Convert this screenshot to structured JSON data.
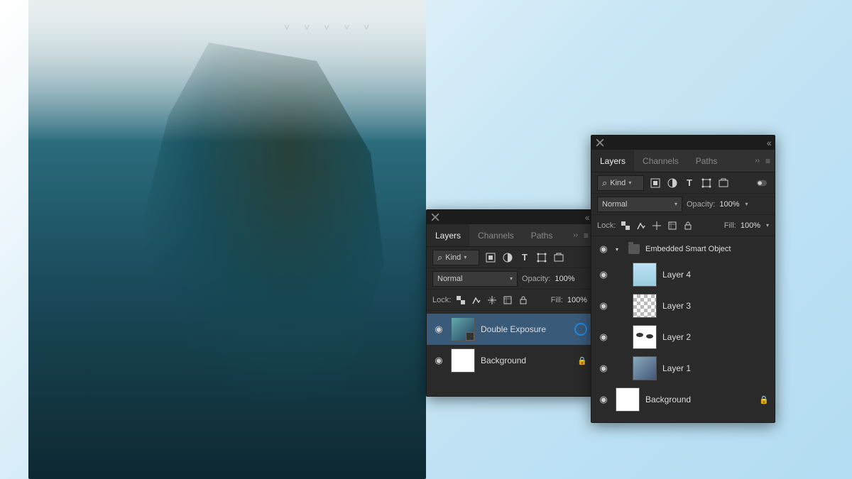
{
  "panels": {
    "left": {
      "tabs": [
        "Layers",
        "Channels",
        "Paths"
      ],
      "activeTab": "Layers",
      "filter": {
        "kind": "Kind"
      },
      "blend": {
        "mode": "Normal",
        "opacityLabel": "Opacity:",
        "opacityValue": "100%"
      },
      "lock": {
        "label": "Lock:",
        "fillLabel": "Fill:",
        "fillValue": "100%"
      },
      "layers": [
        {
          "name": "Double Exposure",
          "selected": true,
          "thumb": "so",
          "busy": true
        },
        {
          "name": "Background",
          "thumb": "white",
          "locked": true
        }
      ]
    },
    "right": {
      "tabs": [
        "Layers",
        "Channels",
        "Paths"
      ],
      "activeTab": "Layers",
      "filter": {
        "kind": "Kind"
      },
      "blend": {
        "mode": "Normal",
        "opacityLabel": "Opacity:",
        "opacityValue": "100%"
      },
      "lock": {
        "label": "Lock:",
        "fillLabel": "Fill:",
        "fillValue": "100%"
      },
      "group": {
        "name": "Embedded Smart Object"
      },
      "layers": [
        {
          "name": "Layer 4",
          "thumb": "sky"
        },
        {
          "name": "Layer 3",
          "thumb": "checker"
        },
        {
          "name": "Layer 2",
          "thumb": "blobs"
        },
        {
          "name": "Layer 1",
          "thumb": "portrait"
        }
      ],
      "background": {
        "name": "Background",
        "locked": true
      }
    }
  },
  "icons": {
    "search": "⌕"
  }
}
